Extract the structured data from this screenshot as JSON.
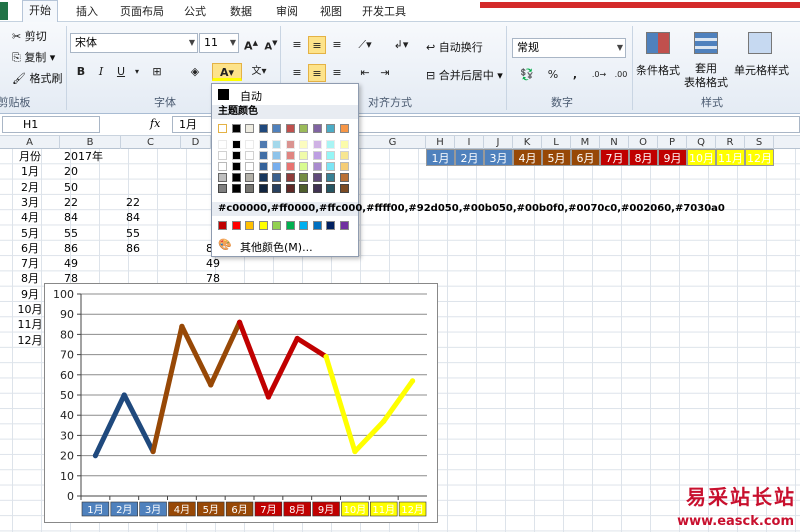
{
  "tabs": [
    "开始",
    "插入",
    "页面布局",
    "公式",
    "数据",
    "审阅",
    "视图",
    "开发工具"
  ],
  "clipboard": {
    "cut": "剪切",
    "copy": "复制",
    "painter": "格式刷",
    "label": "剪贴板"
  },
  "font": {
    "name": "宋体",
    "size": "11",
    "label": "字体"
  },
  "align": {
    "wrap": "自动换行",
    "merge": "合并后居中",
    "label": "对齐方式"
  },
  "number": {
    "format": "常规",
    "label": "数字",
    "percent": "%",
    "comma": ","
  },
  "styles": {
    "cond": "条件格式",
    "table": "套用\n表格格式",
    "cell": "单元格样式",
    "label": "样式"
  },
  "formula": {
    "namebox": "H1",
    "fx": "fx",
    "value": "1月"
  },
  "columns": [
    "A",
    "B",
    "C",
    "D",
    "E",
    "F",
    "G",
    "H",
    "I",
    "J",
    "K",
    "L",
    "M",
    "N",
    "O",
    "P",
    "Q",
    "R",
    "S"
  ],
  "cellsA": [
    "月份",
    "1月",
    "2月",
    "3月",
    "4月",
    "5月",
    "6月",
    "7月",
    "8月",
    "9月",
    "10月",
    "11月",
    "12月"
  ],
  "cellsB": [
    "2017年",
    "20",
    "50",
    "22",
    "84",
    "55",
    "86",
    "49",
    "78"
  ],
  "cellsC": [
    "",
    "",
    "",
    "22",
    "84",
    "55",
    "86"
  ],
  "cellsE": [
    "",
    "",
    "",
    "",
    "",
    "",
    "8",
    "49",
    "78"
  ],
  "header_cells": [
    {
      "label": "1月",
      "bg": "#4f81bd",
      "fg": "#ffffff"
    },
    {
      "label": "2月",
      "bg": "#4f81bd",
      "fg": "#ffffff"
    },
    {
      "label": "3月",
      "bg": "#4f81bd",
      "fg": "#ffffff"
    },
    {
      "label": "4月",
      "bg": "#974806",
      "fg": "#ffffff"
    },
    {
      "label": "5月",
      "bg": "#974806",
      "fg": "#ffffff"
    },
    {
      "label": "6月",
      "bg": "#974806",
      "fg": "#ffffff"
    },
    {
      "label": "7月",
      "bg": "#c00000",
      "fg": "#ffffff"
    },
    {
      "label": "8月",
      "bg": "#c00000",
      "fg": "#ffffff"
    },
    {
      "label": "9月",
      "bg": "#c00000",
      "fg": "#ffffff"
    },
    {
      "label": "10月",
      "bg": "#ffff00",
      "fg": "#ffffff"
    },
    {
      "label": "11月",
      "bg": "#ffff00",
      "fg": "#ffffff"
    },
    {
      "label": "12月",
      "bg": "#ffff00",
      "fg": "#ffffff"
    }
  ],
  "dropdown": {
    "auto": "自动",
    "theme": "主题颜色",
    "standard": [
      "#c00000",
      "#ff0000",
      "#ffc000",
      "#ffff00",
      "#92d050",
      "#00b050",
      "#00b0f0",
      "#0070c0",
      "#002060",
      "#7030a0"
    ],
    "more": "其他颜色(M)...",
    "theme_top": [
      "#ffffff",
      "#000000",
      "#eeece1",
      "#1f497d",
      "#4f81bd",
      "#c0504d",
      "#9bbb59",
      "#8064a2",
      "#4bacc6",
      "#f79646"
    ]
  },
  "chart_data": {
    "type": "line",
    "categories": [
      "1月",
      "2月",
      "3月",
      "4月",
      "5月",
      "6月",
      "7月",
      "8月",
      "9月",
      "10月",
      "11月",
      "12月"
    ],
    "values": [
      20,
      50,
      22,
      84,
      55,
      86,
      49,
      78,
      69,
      22,
      37,
      57
    ],
    "segment_colors": [
      "#1f497d",
      "#1f497d",
      "#974806",
      "#974806",
      "#974806",
      "#c00000",
      "#c00000",
      "#c00000",
      "#ffff00",
      "#ffff00",
      "#ffff00"
    ],
    "ylim": [
      0,
      100
    ],
    "yticks": [
      0,
      10,
      20,
      30,
      40,
      50,
      60,
      70,
      80,
      90,
      100
    ],
    "grid": true
  },
  "watermark": {
    "main": "易采站长站",
    "url": "www.easck.com"
  }
}
